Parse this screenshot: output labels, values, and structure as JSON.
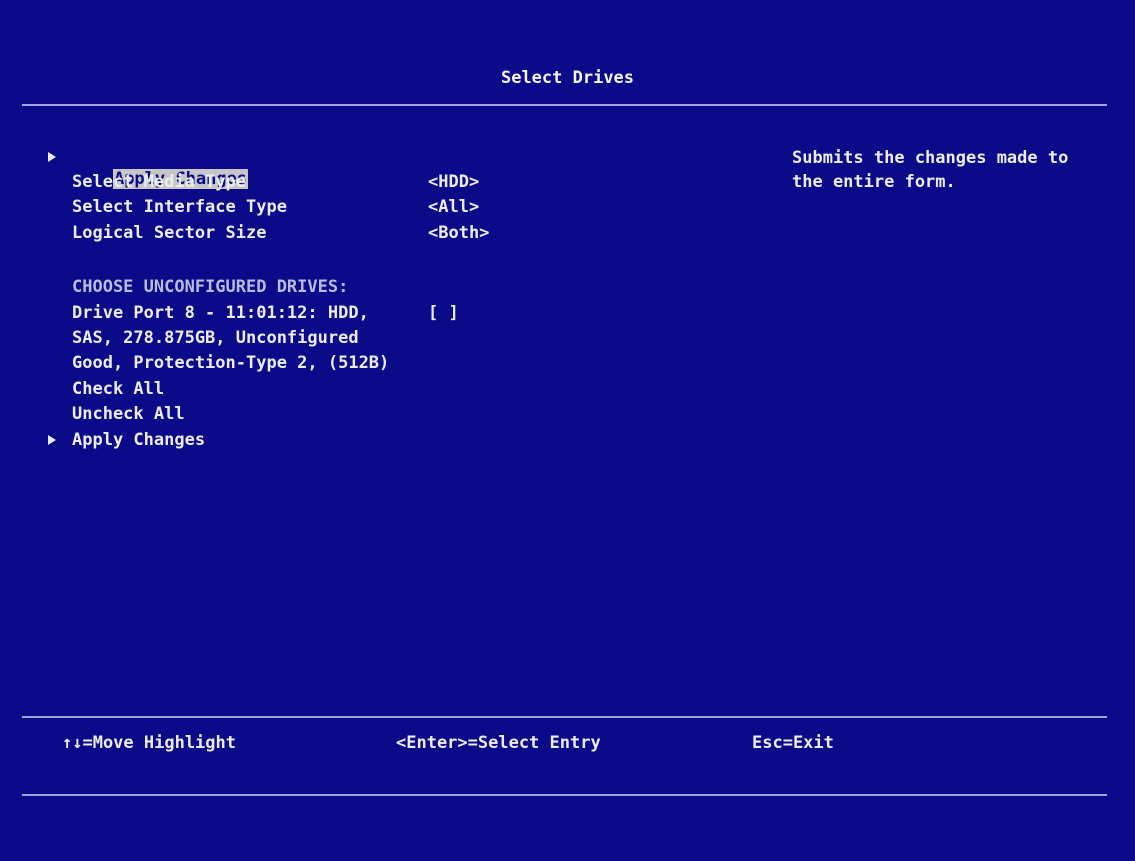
{
  "screen": {
    "title": "Select Drives",
    "help_text": "Submits the changes made to\nthe entire form."
  },
  "menu": {
    "apply_top_label": "Apply Changes",
    "media_type_label": "Select Media Type",
    "media_type_value": "<HDD>",
    "interface_type_label": "Select Interface Type",
    "interface_type_value": "<All>",
    "sector_size_label": "Logical Sector Size",
    "sector_size_value": "<Both>",
    "section_header": "CHOOSE UNCONFIGURED DRIVES:",
    "drive_line1": "Drive Port 8 - 11:01:12: HDD,",
    "drive_line2": "SAS, 278.875GB, Unconfigured",
    "drive_line3": "Good, Protection-Type 2, (512B)",
    "drive_checkbox": "[ ]",
    "check_all_label": "Check All",
    "uncheck_all_label": "Uncheck All",
    "apply_bottom_label": "Apply Changes"
  },
  "footer": {
    "move_hint": "↑↓=Move Highlight",
    "select_hint": "<Enter>=Select Entry",
    "exit_hint": "Esc=Exit"
  },
  "colors": {
    "background": "#0b0b8a",
    "text": "#ececec",
    "highlight": "#c6c6c6",
    "section_header": "#b9bbe0",
    "rule": "#9fa3d6"
  }
}
